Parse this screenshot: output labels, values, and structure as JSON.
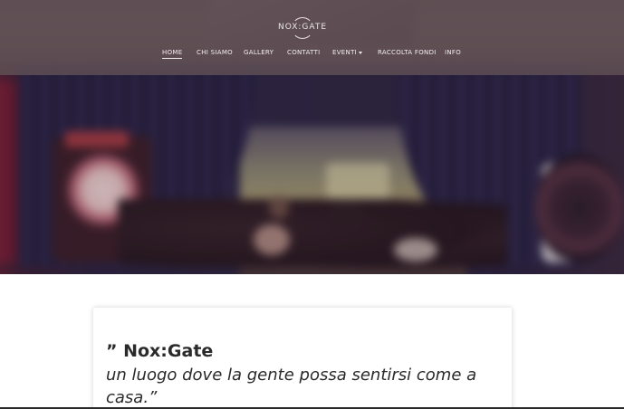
{
  "brand": {
    "logo_text": "NOX:GATE"
  },
  "nav": {
    "items": [
      {
        "label": "HOME",
        "active": true
      },
      {
        "label": "CHI SIAMO",
        "active": false
      },
      {
        "label": "GALLERY",
        "active": false
      },
      {
        "label": "CONTATTI",
        "active": false
      },
      {
        "label": "EVENTI",
        "active": false,
        "has_dropdown": true
      },
      {
        "label": "RACCOLTA FONDI",
        "active": false
      },
      {
        "label": "INFO",
        "active": false
      }
    ]
  },
  "quote": {
    "title": "” Nox:Gate",
    "body": "un luogo dove la gente possa sentirsi come a casa.”"
  },
  "colors": {
    "navbar": "#605056",
    "nav_text": "#f3eef0",
    "text": "#2a2a2a"
  }
}
